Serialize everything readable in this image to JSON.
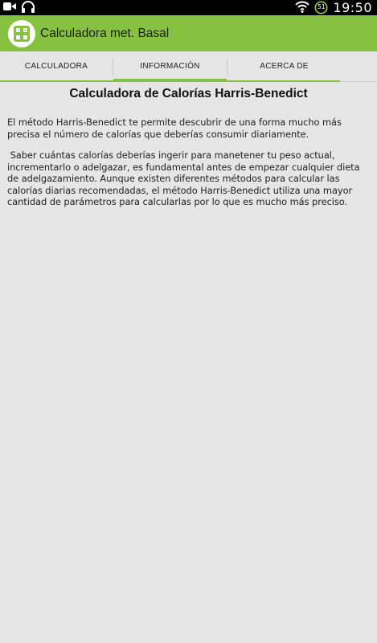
{
  "status_bar": {
    "time": "19:50",
    "battery_level": "51",
    "icons": [
      "video-icon",
      "headphones-icon",
      "wifi-icon",
      "battery-icon"
    ]
  },
  "app_bar": {
    "title": "Calculadora met. Basal",
    "icon": "calculator-icon",
    "color": "#87c142"
  },
  "tabs": [
    {
      "label": "CALCULADORA",
      "active": false
    },
    {
      "label": "INFORMACIÓN",
      "active": true
    },
    {
      "label": "ACERCA DE",
      "active": false
    }
  ],
  "content": {
    "title": "Calculadora de Calorías Harris-Benedict",
    "paragraphs": [
      "El método Harris-Benedict te permite descubrir de una forma mucho más precisa el número de calorías que deberías consumir diariamente.",
      " Saber cuántas calorías deberías ingerir para manetener tu peso actual, incrementarlo o adelgazar, es fundamental antes de empezar cualquier dieta de adelgazamiento. Aunque existen diferentes métodos para calcular las calorías diarias recomendadas, el método Harris-Benedict utiliza una mayor cantidad de parámetros para calcularlas por lo que es mucho más preciso."
    ]
  }
}
